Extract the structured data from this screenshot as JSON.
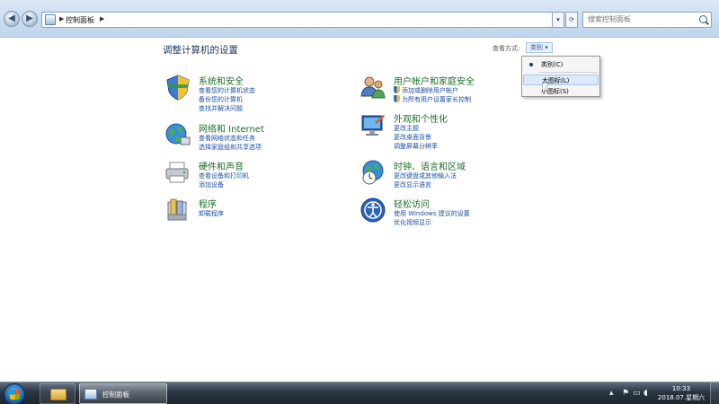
{
  "address": {
    "crumb": "控制面板",
    "search_placeholder": "搜索控制面板"
  },
  "page": {
    "title": "调整计算机的设置",
    "view_by_label": "查看方式:",
    "view_by_value": "类别 ▾"
  },
  "categories": {
    "system": {
      "title": "系统和安全",
      "links": [
        "查看您的计算机状态",
        "备份您的计算机",
        "查找并解决问题"
      ]
    },
    "network": {
      "title": "网络和 Internet",
      "links": [
        "查看网络状态和任务",
        "选择家庭组和共享选项"
      ]
    },
    "hardware": {
      "title": "硬件和声音",
      "links": [
        "查看设备和打印机",
        "添加设备"
      ]
    },
    "programs": {
      "title": "程序",
      "links": [
        "卸载程序"
      ]
    },
    "users": {
      "title": "用户帐户和家庭安全",
      "links": [
        "添加或删除用户帐户",
        "为所有用户设置家长控制"
      ]
    },
    "appearance": {
      "title": "外观和个性化",
      "links": [
        "更改主题",
        "更改桌面背景",
        "调整屏幕分辨率"
      ]
    },
    "clock": {
      "title": "时钟、语言和区域",
      "links": [
        "更改键盘或其他输入法",
        "更改显示语言"
      ]
    },
    "ease": {
      "title": "轻松访问",
      "links": [
        "使用 Windows 建议的设置",
        "优化视频显示"
      ]
    }
  },
  "view_menu": {
    "items": [
      "类别(C)",
      "大图标(L)",
      "小图标(S)"
    ],
    "checked_index": 0,
    "hover_index": 1
  },
  "taskbar": {
    "active_window": "控制面板",
    "time": "10:33",
    "date": "2018.07.星期六"
  },
  "icons": {
    "back": "back-arrow-icon",
    "forward": "forward-arrow-icon",
    "search": "search-icon",
    "start": "windows-start-icon",
    "explorer": "folder-icon",
    "tray": [
      "flag-icon",
      "network-icon",
      "volume-icon"
    ]
  }
}
